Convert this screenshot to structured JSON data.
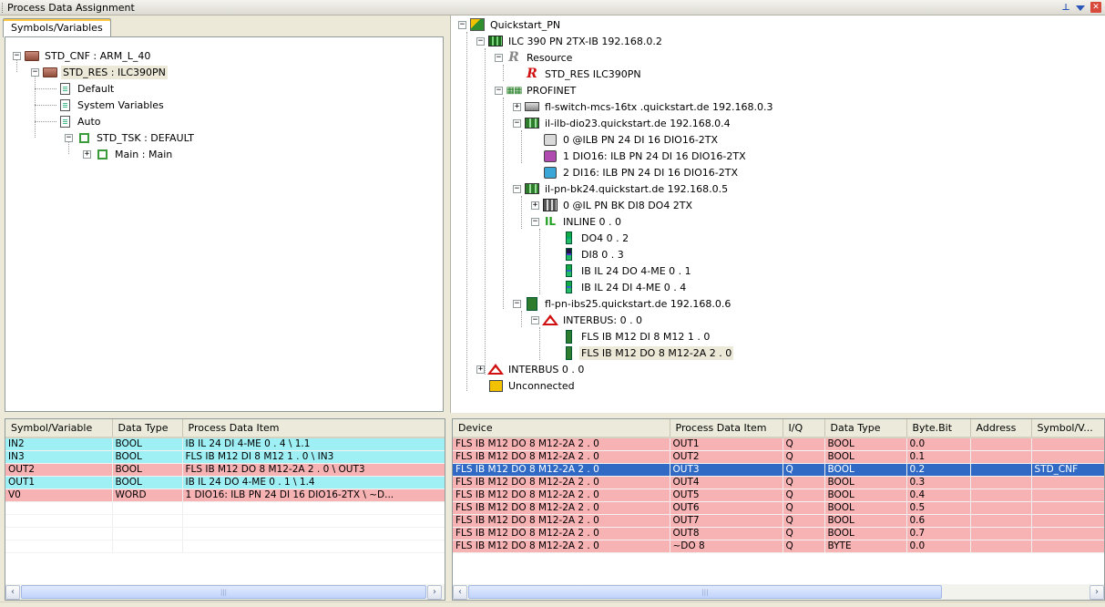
{
  "window": {
    "title": "Process Data Assignment"
  },
  "left_tab": "Symbols/Variables",
  "left_tree": [
    {
      "label": "STD_CNF : ARM_L_40"
    },
    {
      "label": "STD_RES : ILC390PN"
    },
    {
      "label": "Default"
    },
    {
      "label": "System Variables"
    },
    {
      "label": "Auto"
    },
    {
      "label": "STD_TSK : DEFAULT"
    },
    {
      "label": "Main : Main"
    }
  ],
  "right_tree": [
    {
      "label": "Quickstart_PN"
    },
    {
      "label": "ILC 390 PN 2TX-IB 192.168.0.2"
    },
    {
      "label": "Resource"
    },
    {
      "label": "STD_RES ILC390PN"
    },
    {
      "label": "PROFINET"
    },
    {
      "label": "fl-switch-mcs-16tx .quickstart.de 192.168.0.3"
    },
    {
      "label": "il-ilb-dio23.quickstart.de 192.168.0.4"
    },
    {
      "label": "0 @ILB PN 24 DI 16 DIO16-2TX"
    },
    {
      "label": "1 DIO16: ILB PN 24 DI 16 DIO16-2TX"
    },
    {
      "label": "2 DI16: ILB PN 24 DI 16 DIO16-2TX"
    },
    {
      "label": "il-pn-bk24.quickstart.de 192.168.0.5"
    },
    {
      "label": "0 @IL PN BK DI8 DO4 2TX"
    },
    {
      "label": "INLINE 0 . 0"
    },
    {
      "label": "DO4 0 . 2"
    },
    {
      "label": "DI8 0 . 3"
    },
    {
      "label": "IB IL 24 DO 4-ME 0 . 1"
    },
    {
      "label": "IB IL 24 DI 4-ME 0 . 4"
    },
    {
      "label": "fl-pn-ibs25.quickstart.de 192.168.0.6"
    },
    {
      "label": "INTERBUS: 0 . 0"
    },
    {
      "label": "FLS IB M12 DI 8 M12 1 . 0"
    },
    {
      "label": "FLS IB M12 DO 8 M12-2A 2 . 0"
    },
    {
      "label": "INTERBUS 0 . 0"
    },
    {
      "label": "Unconnected"
    }
  ],
  "left_grid": {
    "headers": [
      "Symbol/Variable",
      "Data Type",
      "Process Data Item"
    ],
    "rows": [
      [
        "IN2",
        "BOOL",
        "IB IL 24 DI 4-ME 0 . 4  \\ 1.1"
      ],
      [
        "IN3",
        "BOOL",
        "FLS IB M12 DI 8 M12 1 . 0  \\ IN3"
      ],
      [
        "OUT2",
        "BOOL",
        "FLS IB M12 DO 8 M12-2A 2 . 0  \\ OUT3"
      ],
      [
        "OUT1",
        "BOOL",
        "IB IL 24 DO 4-ME 0 . 1  \\ 1.4"
      ],
      [
        "V0",
        "WORD",
        "1 DIO16: ILB PN 24 DI 16 DIO16-2TX  \\ ~D..."
      ]
    ]
  },
  "right_grid": {
    "headers": [
      "Device",
      "Process Data Item",
      "I/Q",
      "Data Type",
      "Byte.Bit",
      "Address",
      "Symbol/V..."
    ],
    "rows": [
      [
        "FLS IB M12 DO 8 M12-2A 2 . 0",
        "OUT1",
        "Q",
        "BOOL",
        "0.0",
        "",
        ""
      ],
      [
        "FLS IB M12 DO 8 M12-2A 2 . 0",
        "OUT2",
        "Q",
        "BOOL",
        "0.1",
        "",
        ""
      ],
      [
        "FLS IB M12 DO 8 M12-2A 2 . 0",
        "OUT3",
        "Q",
        "BOOL",
        "0.2",
        "",
        "STD_CNF"
      ],
      [
        "FLS IB M12 DO 8 M12-2A 2 . 0",
        "OUT4",
        "Q",
        "BOOL",
        "0.3",
        "",
        ""
      ],
      [
        "FLS IB M12 DO 8 M12-2A 2 . 0",
        "OUT5",
        "Q",
        "BOOL",
        "0.4",
        "",
        ""
      ],
      [
        "FLS IB M12 DO 8 M12-2A 2 . 0",
        "OUT6",
        "Q",
        "BOOL",
        "0.5",
        "",
        ""
      ],
      [
        "FLS IB M12 DO 8 M12-2A 2 . 0",
        "OUT7",
        "Q",
        "BOOL",
        "0.6",
        "",
        ""
      ],
      [
        "FLS IB M12 DO 8 M12-2A 2 . 0",
        "OUT8",
        "Q",
        "BOOL",
        "0.7",
        "",
        ""
      ],
      [
        "FLS IB M12 DO 8 M12-2A 2 . 0",
        "~DO 8",
        "Q",
        "BYTE",
        "0.0",
        "",
        ""
      ]
    ]
  },
  "colors": {
    "cyan_row": "#9ff0f5",
    "pink_row": "#f7b2b4",
    "selected_row": "#316ac5"
  },
  "icons": {
    "pin": "pin-icon",
    "menu": "dropdown-icon",
    "close": "close-icon",
    "scroll_left": "‹",
    "scroll_right": "›"
  }
}
